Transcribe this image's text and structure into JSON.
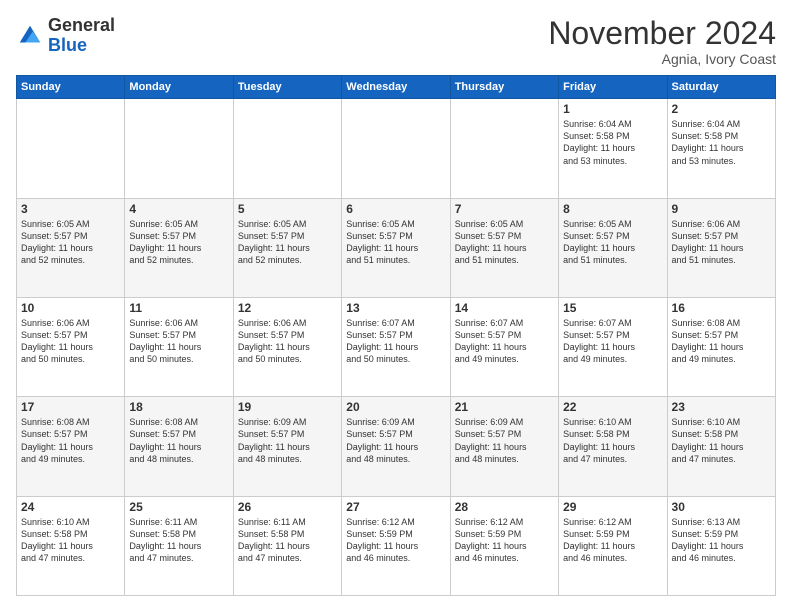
{
  "header": {
    "logo_general": "General",
    "logo_blue": "Blue",
    "month_title": "November 2024",
    "location": "Agnia, Ivory Coast"
  },
  "calendar": {
    "days_of_week": [
      "Sunday",
      "Monday",
      "Tuesday",
      "Wednesday",
      "Thursday",
      "Friday",
      "Saturday"
    ],
    "weeks": [
      [
        {
          "day": "",
          "info": ""
        },
        {
          "day": "",
          "info": ""
        },
        {
          "day": "",
          "info": ""
        },
        {
          "day": "",
          "info": ""
        },
        {
          "day": "",
          "info": ""
        },
        {
          "day": "1",
          "info": "Sunrise: 6:04 AM\nSunset: 5:58 PM\nDaylight: 11 hours\nand 53 minutes."
        },
        {
          "day": "2",
          "info": "Sunrise: 6:04 AM\nSunset: 5:58 PM\nDaylight: 11 hours\nand 53 minutes."
        }
      ],
      [
        {
          "day": "3",
          "info": "Sunrise: 6:05 AM\nSunset: 5:57 PM\nDaylight: 11 hours\nand 52 minutes."
        },
        {
          "day": "4",
          "info": "Sunrise: 6:05 AM\nSunset: 5:57 PM\nDaylight: 11 hours\nand 52 minutes."
        },
        {
          "day": "5",
          "info": "Sunrise: 6:05 AM\nSunset: 5:57 PM\nDaylight: 11 hours\nand 52 minutes."
        },
        {
          "day": "6",
          "info": "Sunrise: 6:05 AM\nSunset: 5:57 PM\nDaylight: 11 hours\nand 51 minutes."
        },
        {
          "day": "7",
          "info": "Sunrise: 6:05 AM\nSunset: 5:57 PM\nDaylight: 11 hours\nand 51 minutes."
        },
        {
          "day": "8",
          "info": "Sunrise: 6:05 AM\nSunset: 5:57 PM\nDaylight: 11 hours\nand 51 minutes."
        },
        {
          "day": "9",
          "info": "Sunrise: 6:06 AM\nSunset: 5:57 PM\nDaylight: 11 hours\nand 51 minutes."
        }
      ],
      [
        {
          "day": "10",
          "info": "Sunrise: 6:06 AM\nSunset: 5:57 PM\nDaylight: 11 hours\nand 50 minutes."
        },
        {
          "day": "11",
          "info": "Sunrise: 6:06 AM\nSunset: 5:57 PM\nDaylight: 11 hours\nand 50 minutes."
        },
        {
          "day": "12",
          "info": "Sunrise: 6:06 AM\nSunset: 5:57 PM\nDaylight: 11 hours\nand 50 minutes."
        },
        {
          "day": "13",
          "info": "Sunrise: 6:07 AM\nSunset: 5:57 PM\nDaylight: 11 hours\nand 50 minutes."
        },
        {
          "day": "14",
          "info": "Sunrise: 6:07 AM\nSunset: 5:57 PM\nDaylight: 11 hours\nand 49 minutes."
        },
        {
          "day": "15",
          "info": "Sunrise: 6:07 AM\nSunset: 5:57 PM\nDaylight: 11 hours\nand 49 minutes."
        },
        {
          "day": "16",
          "info": "Sunrise: 6:08 AM\nSunset: 5:57 PM\nDaylight: 11 hours\nand 49 minutes."
        }
      ],
      [
        {
          "day": "17",
          "info": "Sunrise: 6:08 AM\nSunset: 5:57 PM\nDaylight: 11 hours\nand 49 minutes."
        },
        {
          "day": "18",
          "info": "Sunrise: 6:08 AM\nSunset: 5:57 PM\nDaylight: 11 hours\nand 48 minutes."
        },
        {
          "day": "19",
          "info": "Sunrise: 6:09 AM\nSunset: 5:57 PM\nDaylight: 11 hours\nand 48 minutes."
        },
        {
          "day": "20",
          "info": "Sunrise: 6:09 AM\nSunset: 5:57 PM\nDaylight: 11 hours\nand 48 minutes."
        },
        {
          "day": "21",
          "info": "Sunrise: 6:09 AM\nSunset: 5:57 PM\nDaylight: 11 hours\nand 48 minutes."
        },
        {
          "day": "22",
          "info": "Sunrise: 6:10 AM\nSunset: 5:58 PM\nDaylight: 11 hours\nand 47 minutes."
        },
        {
          "day": "23",
          "info": "Sunrise: 6:10 AM\nSunset: 5:58 PM\nDaylight: 11 hours\nand 47 minutes."
        }
      ],
      [
        {
          "day": "24",
          "info": "Sunrise: 6:10 AM\nSunset: 5:58 PM\nDaylight: 11 hours\nand 47 minutes."
        },
        {
          "day": "25",
          "info": "Sunrise: 6:11 AM\nSunset: 5:58 PM\nDaylight: 11 hours\nand 47 minutes."
        },
        {
          "day": "26",
          "info": "Sunrise: 6:11 AM\nSunset: 5:58 PM\nDaylight: 11 hours\nand 47 minutes."
        },
        {
          "day": "27",
          "info": "Sunrise: 6:12 AM\nSunset: 5:59 PM\nDaylight: 11 hours\nand 46 minutes."
        },
        {
          "day": "28",
          "info": "Sunrise: 6:12 AM\nSunset: 5:59 PM\nDaylight: 11 hours\nand 46 minutes."
        },
        {
          "day": "29",
          "info": "Sunrise: 6:12 AM\nSunset: 5:59 PM\nDaylight: 11 hours\nand 46 minutes."
        },
        {
          "day": "30",
          "info": "Sunrise: 6:13 AM\nSunset: 5:59 PM\nDaylight: 11 hours\nand 46 minutes."
        }
      ]
    ]
  }
}
